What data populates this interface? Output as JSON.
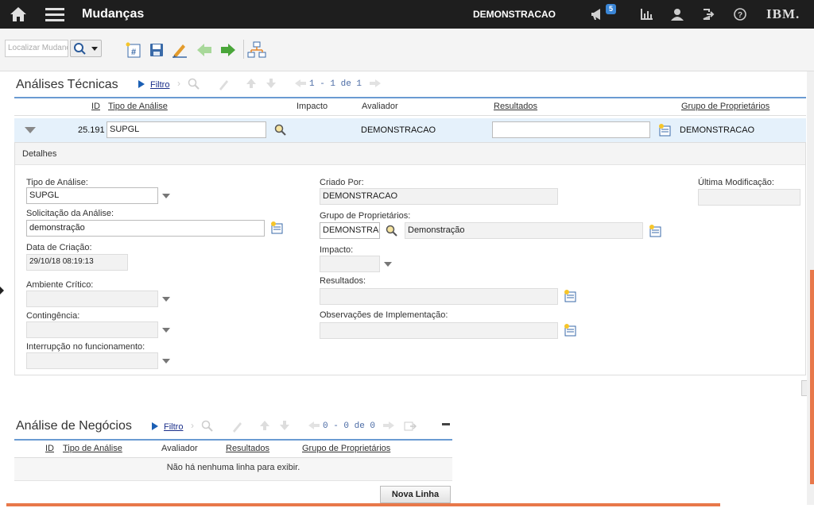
{
  "header": {
    "title": "Mudanças",
    "user": "DEMONSTRACAO",
    "notifications_count": "5",
    "brand": "IBM.",
    "icons": [
      "home-icon",
      "menu-icon",
      "megaphone-icon",
      "reports-icon",
      "profile-icon",
      "signout-icon",
      "help-icon"
    ]
  },
  "toolbar": {
    "search_placeholder": "Localizar Mudança",
    "icons": [
      "new-record-icon",
      "save-icon",
      "change-status-icon",
      "previous-record-icon",
      "next-record-icon",
      "workflow-icon"
    ]
  },
  "analises_tecnicas": {
    "title": "Análises Técnicas",
    "filter_label": "Filtro",
    "pager": "1 - 1 de 1",
    "columns": [
      "ID",
      "Tipo de Análise",
      "Impacto",
      "Avaliador",
      "Resultados",
      "Grupo de Proprietários"
    ],
    "row": {
      "id": "25.191",
      "tipo": "SUPGL",
      "impacto": "",
      "avaliador": "DEMONSTRACAO",
      "resultados": "",
      "grupo": "DEMONSTRACAO"
    }
  },
  "details": {
    "title": "Detalhes",
    "tipo_label": "Tipo de Análise:",
    "tipo_value": "SUPGL",
    "solicitacao_label": "Solicitação da Análise:",
    "solicitacao_value": "demonstração",
    "data_criacao_label": "Data de Criação:",
    "data_criacao_value": "29/10/18 08:19:13",
    "ambiente_label": "Ambiente Crítico:",
    "ambiente_value": "",
    "contingencia_label": "Contingência:",
    "contingencia_value": "",
    "interrupcao_label": "Interrupção no funcionamento:",
    "interrupcao_value": "",
    "criado_por_label": "Criado Por:",
    "criado_por_value": "DEMONSTRACAO",
    "grupo_label": "Grupo de Proprietários:",
    "grupo_value": "DEMONSTRACAO",
    "grupo_desc": "Demonstração",
    "impacto_label": "Impacto:",
    "impacto_value": "",
    "resultados_label": "Resultados:",
    "resultados_value": "",
    "observacoes_label": "Observações de Implementação:",
    "observacoes_value": "",
    "ultima_mod_label": "Última Modificação:",
    "ultima_mod_value": ""
  },
  "analise_negocios": {
    "title": "Análise de Negócios",
    "filter_label": "Filtro",
    "pager": "0 - 0 de 0",
    "columns": [
      "ID",
      "Tipo de Análise",
      "Avaliador",
      "Resultados",
      "Grupo de Proprietários"
    ],
    "empty_message": "Não há nenhuma linha para exibir.",
    "new_row_button": "Nova Linha"
  },
  "colors": {
    "topbar": "#1e1e1e",
    "accent_blue": "#6a9bd2",
    "row_highlight": "#e5f1fb",
    "link": "#1b2f8a",
    "scroll_orange": "#e8784a"
  }
}
